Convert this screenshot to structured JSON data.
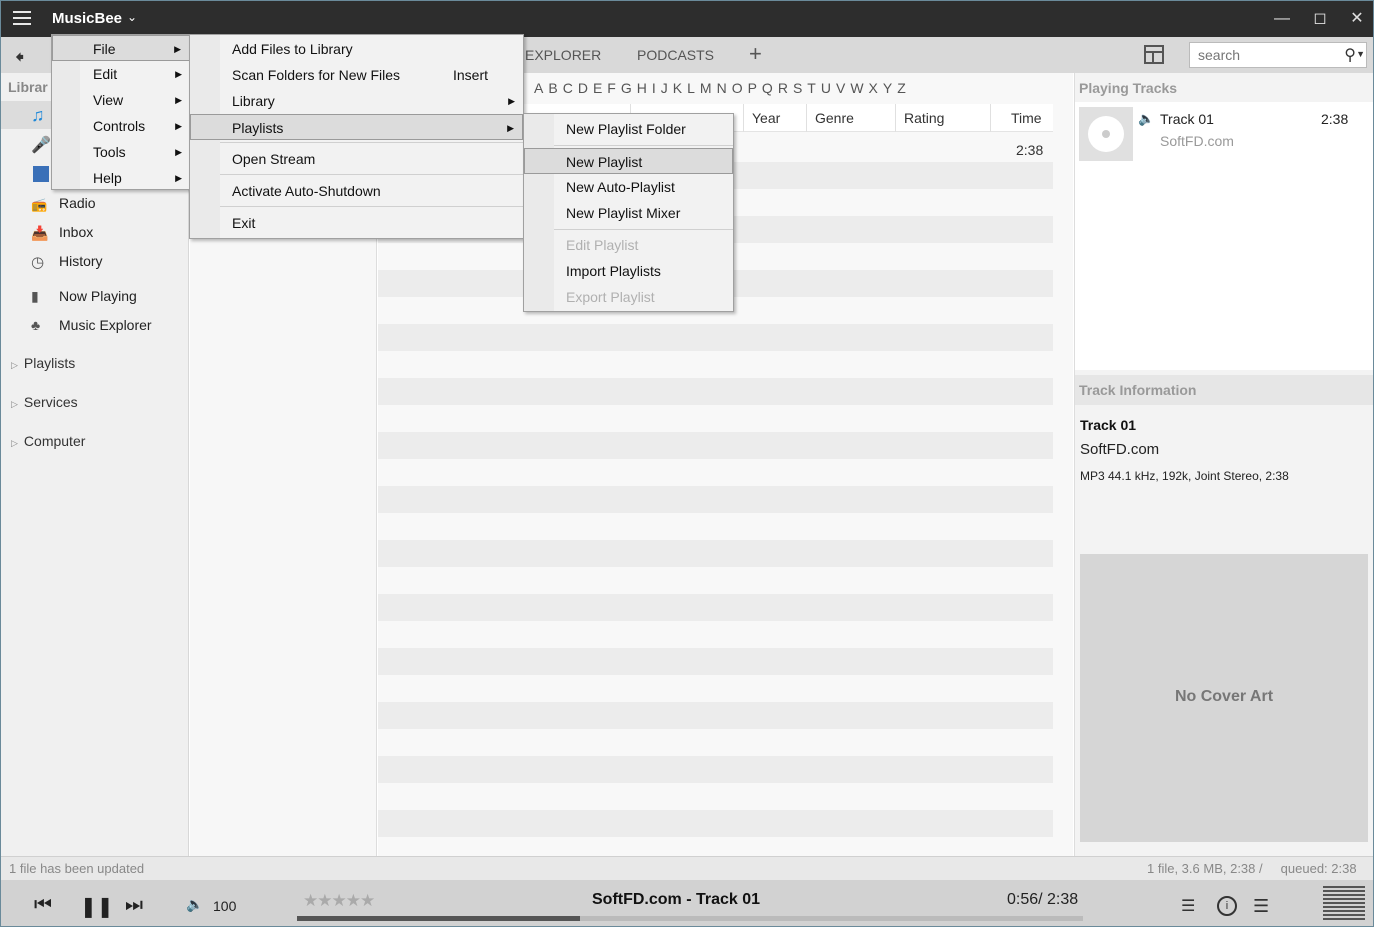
{
  "app": {
    "title": "MusicBee"
  },
  "toolbar": {
    "tabs": [
      "EXPLORER",
      "PODCASTS"
    ],
    "add_tab": "+",
    "search_placeholder": "search"
  },
  "sidebar": {
    "header": "Librar",
    "items": [
      {
        "label": "Radio",
        "icon": "radio-icon"
      },
      {
        "label": "Inbox",
        "icon": "inbox-icon"
      },
      {
        "label": "History",
        "icon": "history-icon"
      },
      {
        "label": "Now Playing",
        "icon": "bar-chart-icon"
      },
      {
        "label": "Music Explorer",
        "icon": "music-explorer-icon"
      }
    ],
    "groups": [
      "Playlists",
      "Services",
      "Computer"
    ]
  },
  "main": {
    "alphabet": [
      "A",
      "B",
      "C",
      "D",
      "E",
      "F",
      "G",
      "H",
      "I",
      "J",
      "K",
      "L",
      "M",
      "N",
      "O",
      "P",
      "Q",
      "R",
      "S",
      "T",
      "U",
      "V",
      "W",
      "X",
      "Y",
      "Z"
    ],
    "columns": [
      "Year",
      "Genre",
      "Rating",
      "Time"
    ],
    "rows": [
      {
        "time": "2:38"
      }
    ]
  },
  "right": {
    "playing_header": "Playing Tracks",
    "playing_track": {
      "title": "Track 01",
      "artist": "SoftFD.com",
      "time": "2:38"
    },
    "info_header": "Track Information",
    "info": {
      "title": "Track 01",
      "artist": "SoftFD.com",
      "details": "MP3 44.1 kHz, 192k, Joint Stereo, 2:38"
    },
    "cover_text": "No Cover Art"
  },
  "status": {
    "left": "1 file has been updated",
    "right": "1 file, 3.6 MB, 2:38 /     queued: 2:38"
  },
  "player": {
    "volume": "100",
    "stars": "★★★★★",
    "now_playing": "SoftFD.com - Track 01",
    "time": "0:56/ 2:38",
    "progress": 0.36
  },
  "menus": {
    "main": [
      "File",
      "Edit",
      "View",
      "Controls",
      "Tools",
      "Help"
    ],
    "file": [
      {
        "label": "Add Files to Library"
      },
      {
        "label": "Scan Folders for New Files",
        "shortcut": "Insert"
      },
      {
        "label": "Library"
      },
      {
        "label": "Playlists"
      },
      {
        "label": "Open Stream"
      },
      {
        "label": "Activate Auto-Shutdown"
      },
      {
        "label": "Exit"
      }
    ],
    "playlists": [
      {
        "label": "New Playlist Folder"
      },
      {
        "label": "New Playlist"
      },
      {
        "label": "New Auto-Playlist"
      },
      {
        "label": "New Playlist Mixer"
      },
      {
        "label": "Edit Playlist"
      },
      {
        "label": "Import Playlists"
      },
      {
        "label": "Export Playlist"
      }
    ]
  },
  "colors": {
    "titlebar": "#2d2d2d",
    "menu_highlight": "#dcdcdc",
    "accent_icon": "#1e88d8"
  }
}
